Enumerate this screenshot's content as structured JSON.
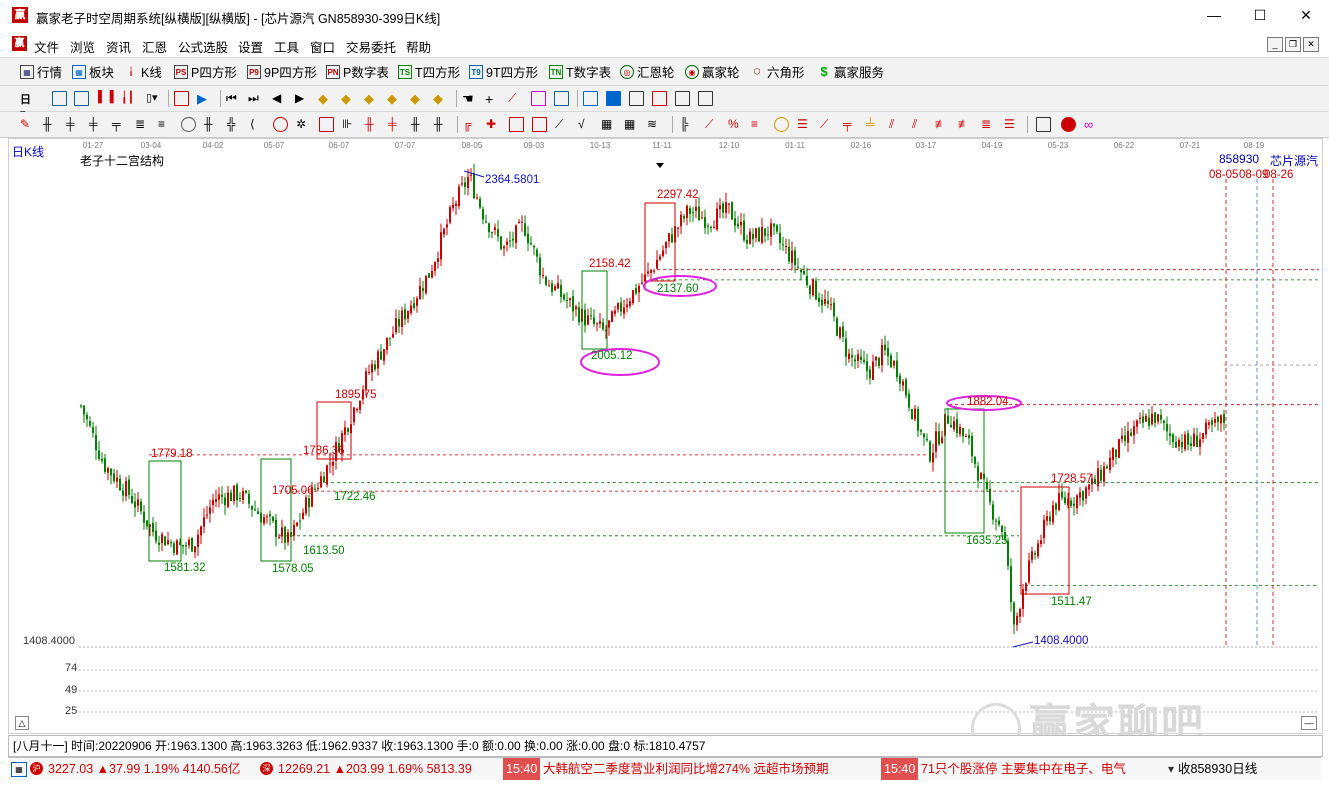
{
  "window": {
    "title": "赢家老子时空周期系统[纵横版][纵横版] - [芯片源汽  GN858930-399日K线]",
    "logo_char": "赢",
    "minimize": "—",
    "maximize": "☐",
    "close": "✕"
  },
  "menu": [
    "文件",
    "浏览",
    "资讯",
    "汇恩",
    "公式选股",
    "设置",
    "工具",
    "窗口",
    "交易委托",
    "帮助"
  ],
  "toolbar1": [
    {
      "label": "行情",
      "icon": "grid-icon"
    },
    {
      "label": "板块",
      "icon": "blocks-icon"
    },
    {
      "label": "K线",
      "icon": "candle-icon"
    },
    {
      "label": "P四方形",
      "icon": "ps-icon",
      "tag": "PS"
    },
    {
      "label": "9P四方形",
      "icon": "p9-icon",
      "tag": "P9"
    },
    {
      "label": "P数字表",
      "icon": "pn-icon",
      "tag": "PN"
    },
    {
      "label": "T四方形",
      "icon": "ts-icon",
      "tag": "TS"
    },
    {
      "label": "9T四方形",
      "icon": "t9-icon",
      "tag": "T9"
    },
    {
      "label": "T数字表",
      "icon": "tn-icon",
      "tag": "TN"
    },
    {
      "label": "汇恩轮",
      "icon": "wheel-icon"
    },
    {
      "label": "赢家轮",
      "icon": "wheel2-icon"
    },
    {
      "label": "六角形",
      "icon": "hexagon-icon"
    },
    {
      "label": "赢家服务",
      "icon": "dollar-icon"
    }
  ],
  "chart": {
    "period_label": "日K线",
    "indicator_title": "老子十二宫结构",
    "code": "858930",
    "name": "芯片源汽",
    "date_axis": [
      "01-27",
      "03-04",
      "04-02",
      "05-07",
      "06-07",
      "07-07",
      "08-05",
      "09-03",
      "10-13",
      "11-11",
      "12-10",
      "01-11",
      "02-16",
      "03-17",
      "04-19",
      "05-23",
      "06-22",
      "07-21",
      "08-19"
    ],
    "right_dates": [
      "08-05",
      "08-09",
      "08-26"
    ],
    "left_low_label": "1408.4000",
    "sub_ticks": [
      "74",
      "49",
      "25"
    ],
    "price_labels": {
      "p2364": "2364.5801",
      "p2297": "2297.42",
      "p2158": "2158.42",
      "p2137": "2137.60",
      "p2005": "2005.12",
      "p1895": "1895.75",
      "p1882": "1882.04",
      "p1779": "1779.18",
      "p1786": "1786.36",
      "p1728": "1728.57",
      "p1722": "1722.46",
      "p1705": "1705.06",
      "p1635": "1635.25",
      "p1613": "1613.50",
      "p1581": "1581.32",
      "p1578": "1578.05",
      "p1511": "1511.47",
      "p1408": "1408.4000"
    },
    "watermark": "赢家聊吧"
  },
  "status": {
    "text": "[八月十一] 时间:20220906 开:1963.1300 高:1963.3263 低:1962.9337 收:1963.1300 手:0 额:0.00 换:0.00 涨:0.00 盘:0 标:1810.4757"
  },
  "ticker": {
    "sh": "3227.03 ▲37.99 1.19% 4140.56亿",
    "sz": "12269.21 ▲203.99 1.69% 5813.39",
    "news1_time": "15:40",
    "news1": "大韩航空二季度营业利润同比增274% 远超市场预期",
    "news2_time": "15:40",
    "news2": "71只个股涨停 主要集中在电子、电气",
    "right": "收858930日线"
  },
  "colors": {
    "up": "#cc0000",
    "down": "#008000",
    "magenta": "#e020e0",
    "blue": "#1010c0"
  }
}
